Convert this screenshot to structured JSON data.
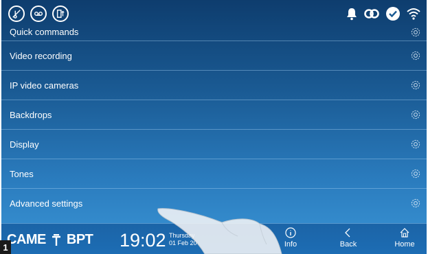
{
  "menu": {
    "items": [
      {
        "label": "Quick commands",
        "icon": "gear-icon"
      },
      {
        "label": "Video recording",
        "icon": "gear-icon"
      },
      {
        "label": "IP video cameras",
        "icon": "gear-icon"
      },
      {
        "label": "Backdrops",
        "icon": "gear-icon"
      },
      {
        "label": "Display",
        "icon": "gear-icon"
      },
      {
        "label": "Tones",
        "icon": "gear-icon"
      },
      {
        "label": "Advanced settings",
        "icon": "gear-icon"
      }
    ]
  },
  "footer": {
    "brand_left": "CAME",
    "brand_right": "BPT",
    "time": "19:02",
    "day": "Thursday",
    "date": "01 Feb 20",
    "info_label": "Info",
    "back_label": "Back",
    "home_label": "Home"
  },
  "page_number": "1",
  "colors": {
    "background_top": "#0e3d6e",
    "background_bottom": "#3a95d6",
    "text": "#ffffff"
  }
}
